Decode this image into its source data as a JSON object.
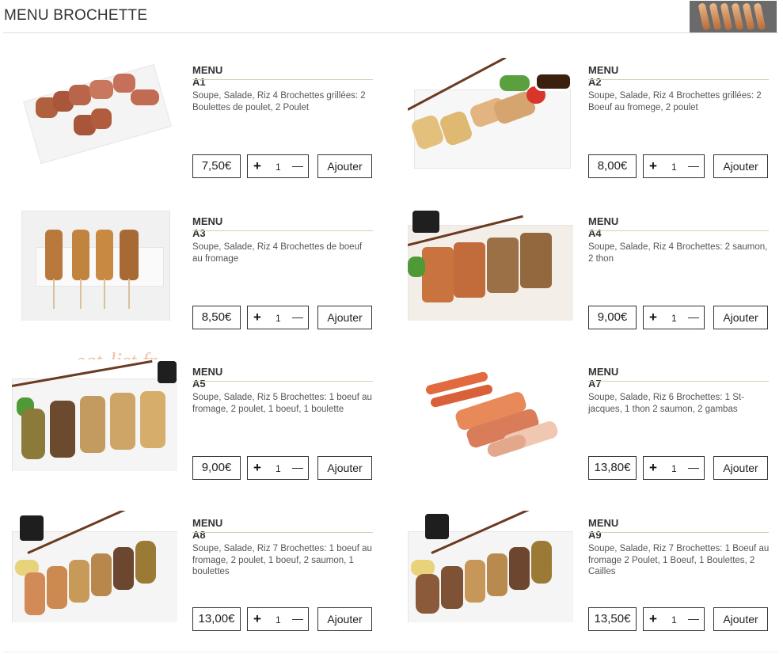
{
  "page": {
    "title": "MENU BROCHETTE",
    "watermark": "eat-list.fr"
  },
  "colors": {
    "divider": "#d8cfb6",
    "border": "#333333"
  },
  "menus": [
    {
      "name": "MENU A1",
      "description": "Soupe, Salade, Riz 4 Brochettes grillées: 2 Boulettes de poulet, 2 Poulet",
      "price": "7,50€",
      "qty": "1",
      "add_label": "Ajouter",
      "qty_plus": "+"
    },
    {
      "name": "MENU A2",
      "description": "Soupe, Salade, Riz 4 Brochettes grillées: 2 Boeuf au fromege, 2 poulet",
      "price": "8,00€",
      "qty": "1",
      "add_label": "Ajouter",
      "qty_plus": "+"
    },
    {
      "name": "MENU A3",
      "description": "Soupe, Salade, Riz 4 Brochettes de boeuf au fromage",
      "price": "8,50€",
      "qty": "1",
      "add_label": "Ajouter",
      "qty_plus": "+"
    },
    {
      "name": "MENU A4",
      "description": "Soupe, Salade, Riz 4 Brochettes: 2 saumon, 2 thon",
      "price": "9,00€",
      "qty": "1",
      "add_label": "Ajouter",
      "qty_plus": "+"
    },
    {
      "name": "MENU A5",
      "description": "Soupe, Salade, Riz 5 Brochettes: 1 boeuf au fromage, 2 poulet, 1 boeuf, 1 boulette",
      "price": "9,00€",
      "qty": "1",
      "add_label": "Ajouter",
      "qty_plus": "+"
    },
    {
      "name": "MENU A7",
      "description": "Soupe, Salade, Riz 6 Brochettes: 1 St-jacques, 1 thon 2 saumon, 2 gambas",
      "price": "13,80€",
      "qty": "1",
      "add_label": "Ajouter",
      "qty_plus": "+"
    },
    {
      "name": "MENU A8",
      "description": "Soupe, Salade, Riz 7 Brochettes: 1 boeuf au fromage, 2 poulet, 1 boeuf, 2 saumon, 1 boulettes",
      "price": "13,00€",
      "qty": "1",
      "add_label": "Ajouter",
      "qty_plus": "+"
    },
    {
      "name": "MENU A9",
      "description": "Soupe, Salade, Riz 7 Brochettes: 1 Boeuf au fromage 2 Poulet, 1 Boeuf, 1 Boulettes, 2 Cailles",
      "price": "13,50€",
      "qty": "1",
      "add_label": "Ajouter",
      "qty_plus": "+"
    }
  ]
}
